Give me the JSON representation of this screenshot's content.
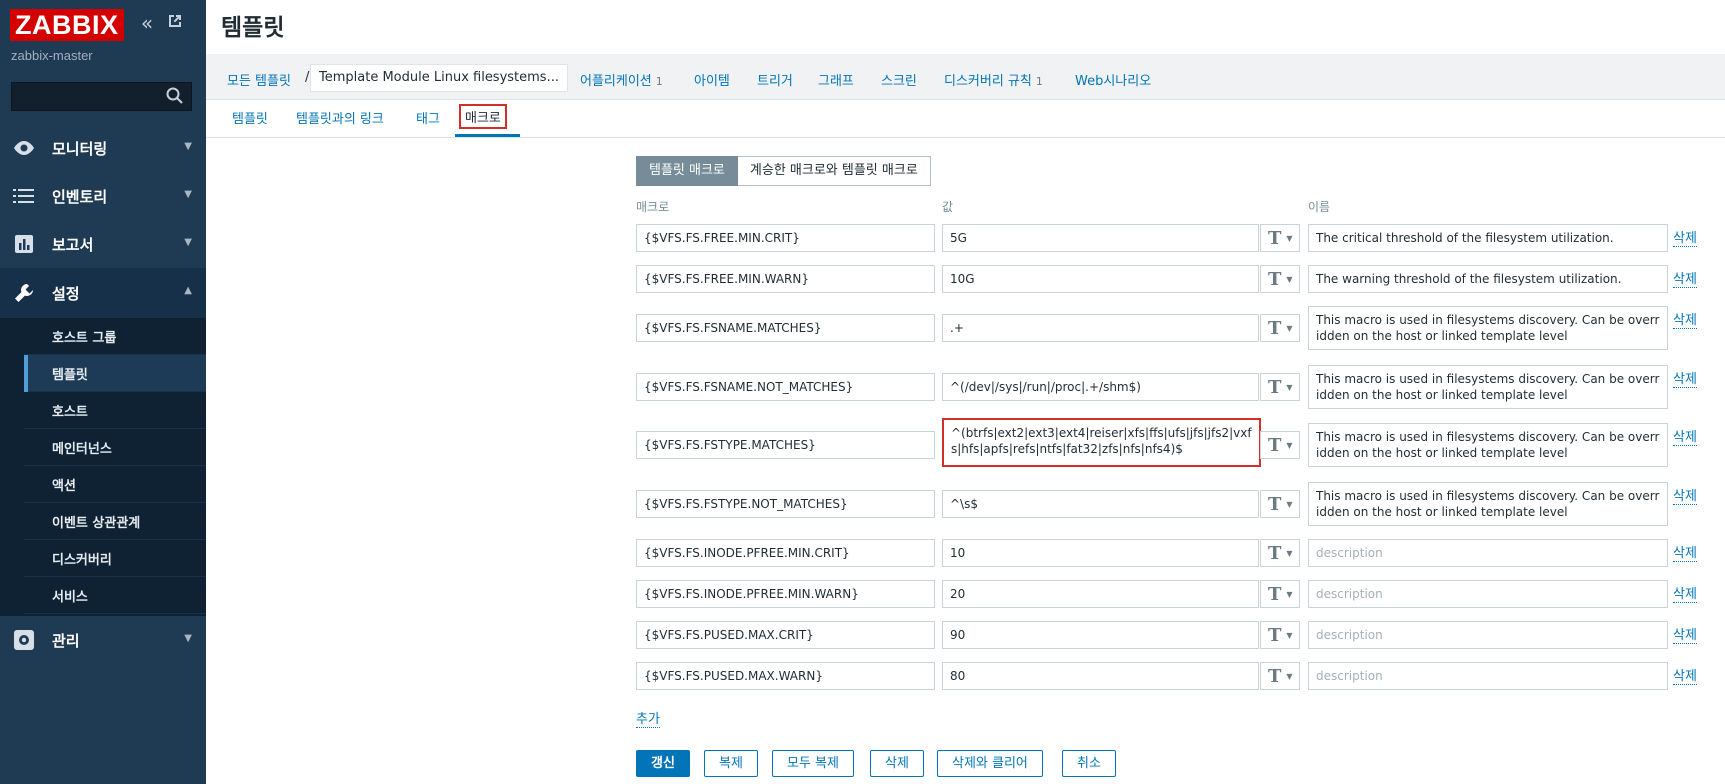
{
  "sidebar": {
    "logo": "ZABBIX",
    "server_name": "zabbix-master",
    "collapse_icon": "collapse-icon",
    "kiosk_icon": "kiosk-icon",
    "search": {
      "value": "",
      "icon": "search-icon"
    },
    "nav": [
      {
        "label": "모니터링",
        "icon": "eye-icon",
        "expanded": false
      },
      {
        "label": "인벤토리",
        "icon": "list-icon",
        "expanded": false
      },
      {
        "label": "보고서",
        "icon": "report-icon",
        "expanded": false
      },
      {
        "label": "설정",
        "icon": "wrench-icon",
        "expanded": true
      },
      {
        "label": "관리",
        "icon": "gear-icon",
        "expanded": false
      }
    ],
    "config_submenu": [
      {
        "label": "호스트 그룹",
        "active": false
      },
      {
        "label": "템플릿",
        "active": true
      },
      {
        "label": "호스트",
        "active": false
      },
      {
        "label": "메인터넌스",
        "active": false
      },
      {
        "label": "액션",
        "active": false
      },
      {
        "label": "이벤트 상관관계",
        "active": false
      },
      {
        "label": "디스커버리",
        "active": false
      },
      {
        "label": "서비스",
        "active": false
      }
    ]
  },
  "header": {
    "title": "템플릿"
  },
  "breadcrumb": {
    "all_templates": "모든 템플릿",
    "separator": "/",
    "current": "Template Module Linux filesystems...",
    "links": [
      {
        "label": "어플리케이션",
        "count": "1"
      },
      {
        "label": "아이템",
        "count": ""
      },
      {
        "label": "트리거",
        "count": ""
      },
      {
        "label": "그래프",
        "count": ""
      },
      {
        "label": "스크린",
        "count": ""
      },
      {
        "label": "디스커버리 규칙",
        "count": "1"
      },
      {
        "label": "Web시나리오",
        "count": ""
      }
    ]
  },
  "tabs": [
    {
      "label": "템플릿",
      "active": false
    },
    {
      "label": "템플릿과의 링크",
      "active": false
    },
    {
      "label": "태그",
      "active": false
    },
    {
      "label": "매크로",
      "active": true
    }
  ],
  "macros_form": {
    "segment": {
      "template_macros": "템플릿 매크로",
      "inherited_macros": "계승한 매크로와 템플릿 매크로"
    },
    "columns": {
      "macro": "매크로",
      "value": "값",
      "description": "이름"
    },
    "type_glyph": "T",
    "delete_label": "삭제",
    "description_placeholder": "description",
    "rows": [
      {
        "macro": "{$VFS.FS.FREE.MIN.CRIT}",
        "value": "5G",
        "description": "The critical threshold of the filesystem utilization."
      },
      {
        "macro": "{$VFS.FS.FREE.MIN.WARN}",
        "value": "10G",
        "description": "The warning threshold of the filesystem utilization."
      },
      {
        "macro": "{$VFS.FS.FSNAME.MATCHES}",
        "value": ".+",
        "description": "This macro is used in filesystems discovery. Can be overridden on the host or linked template level"
      },
      {
        "macro": "{$VFS.FS.FSNAME.NOT_MATCHES}",
        "value": "^(/dev|/sys|/run|/proc|.+/shm$)",
        "description": "This macro is used in filesystems discovery. Can be overridden on the host or linked template level"
      },
      {
        "macro": "{$VFS.FS.FSTYPE.MATCHES}",
        "value": "^(btrfs|ext2|ext3|ext4|reiser|xfs|ffs|ufs|jfs|jfs2|vxfs|hfs|apfs|refs|ntfs|fat32|zfs|nfs|nfs4)$",
        "description": "This macro is used in filesystems discovery. Can be overridden on the host or linked template level"
      },
      {
        "macro": "{$VFS.FS.FSTYPE.NOT_MATCHES}",
        "value": "^\\s$",
        "description": "This macro is used in filesystems discovery. Can be overridden on the host or linked template level"
      },
      {
        "macro": "{$VFS.FS.INODE.PFREE.MIN.CRIT}",
        "value": "10",
        "description": ""
      },
      {
        "macro": "{$VFS.FS.INODE.PFREE.MIN.WARN}",
        "value": "20",
        "description": ""
      },
      {
        "macro": "{$VFS.FS.PUSED.MAX.CRIT}",
        "value": "90",
        "description": ""
      },
      {
        "macro": "{$VFS.FS.PUSED.MAX.WARN}",
        "value": "80",
        "description": ""
      }
    ],
    "add_label": "추가",
    "buttons": {
      "update": "갱신",
      "clone": "복제",
      "full_clone": "모두 복제",
      "delete": "삭제",
      "delete_clear": "삭제와 클리어",
      "cancel": "취소"
    }
  },
  "colors": {
    "sidebar_bg": "#1f3a53",
    "brand_red": "#d40000",
    "link_blue": "#0275b8",
    "highlight_red": "#d0302a"
  }
}
